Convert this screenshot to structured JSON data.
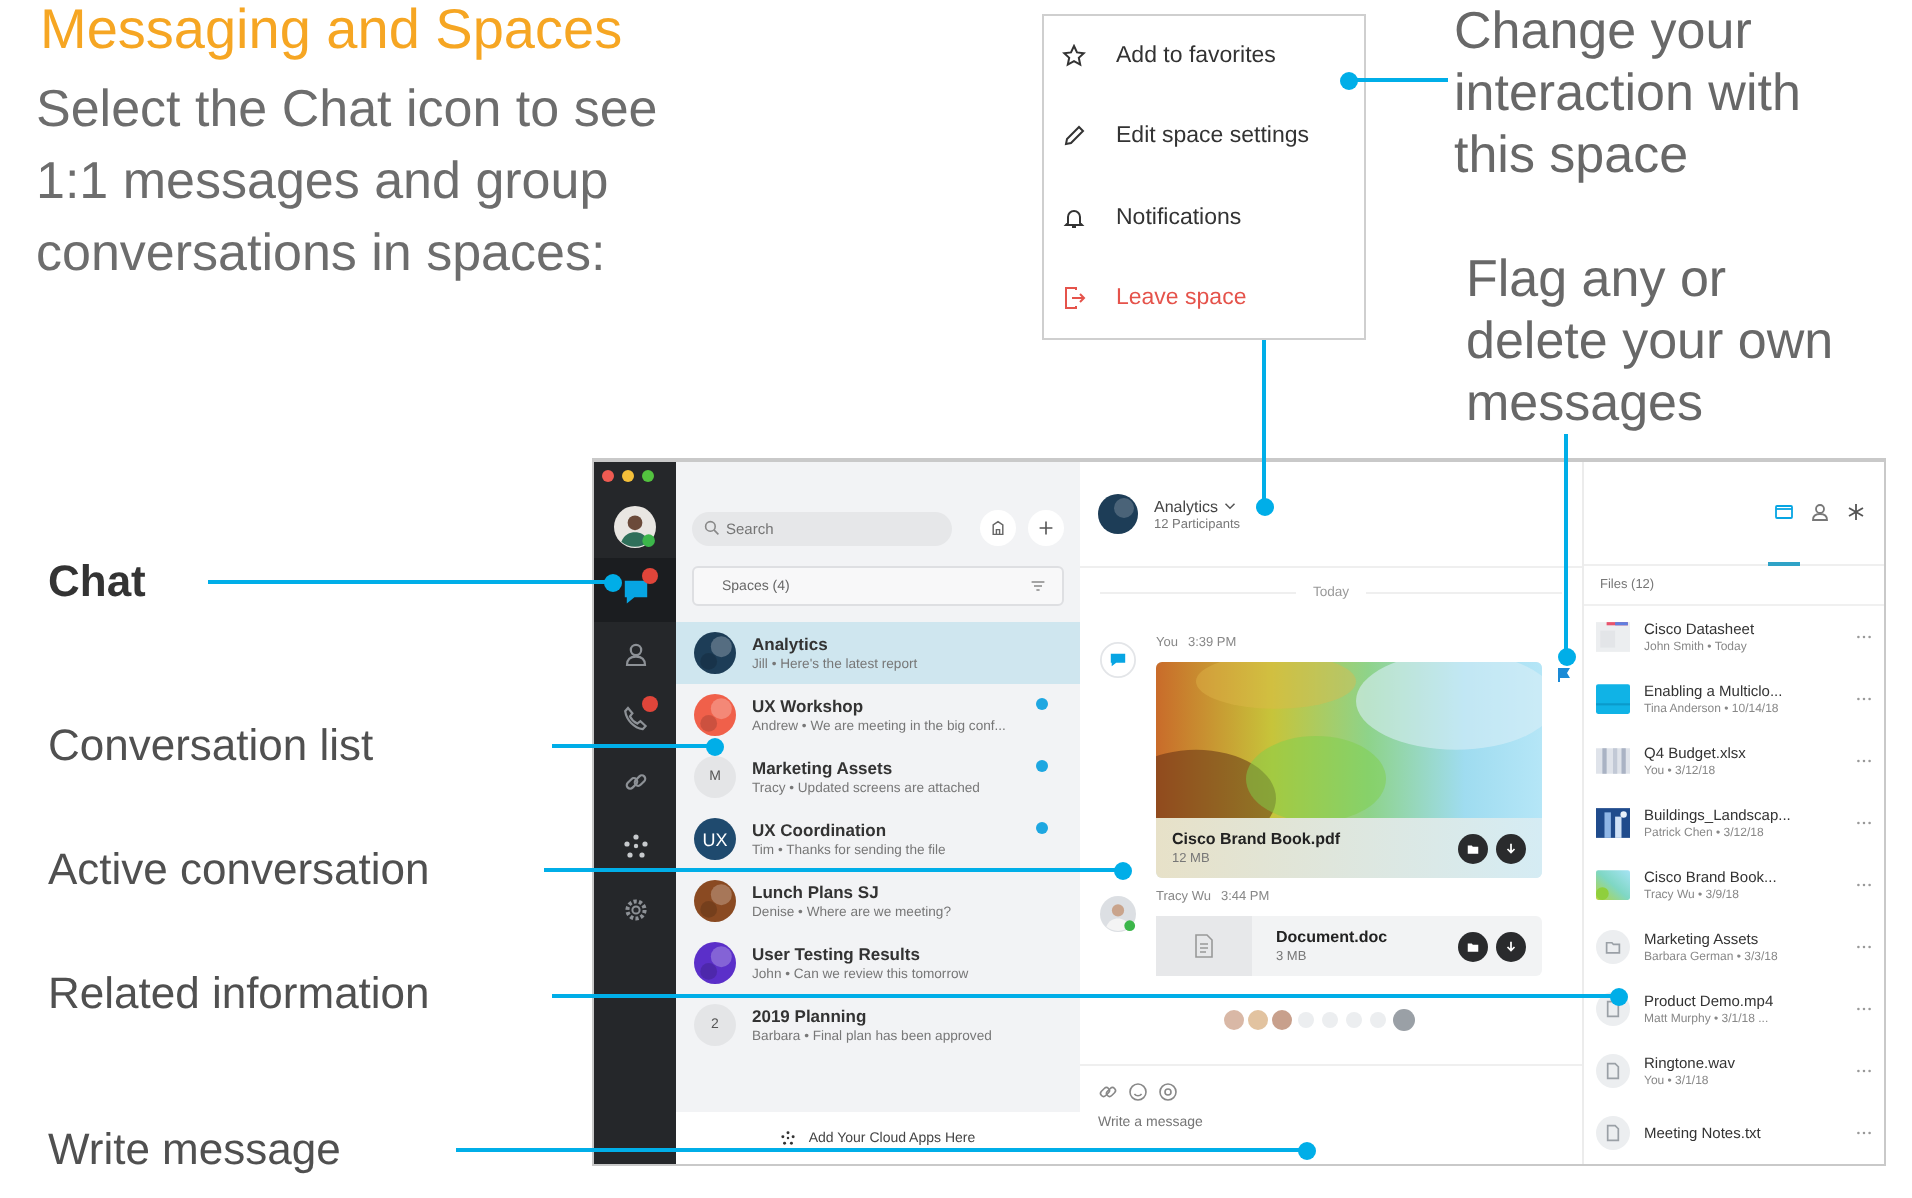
{
  "title": "Messaging and Spaces",
  "intro": "Select the Chat icon to see 1:1 messages and group conversations in spaces:",
  "space_menu": {
    "items": [
      {
        "kind": "favorite",
        "label": "Add to favorites"
      },
      {
        "kind": "edit",
        "label": "Edit space settings"
      },
      {
        "kind": "notifications",
        "label": "Notifications"
      },
      {
        "kind": "leave",
        "label": "Leave space"
      }
    ]
  },
  "callouts": {
    "menu": "Change your interaction with this space",
    "flag": "Flag any or delete your own messages",
    "chat": "Chat",
    "conversation_list": "Conversation list",
    "active_conversation": "Active conversation",
    "related_information": "Related information",
    "write_message": "Write message"
  },
  "app": {
    "sidebar": [
      {
        "kind": "avatar",
        "selected": false,
        "badge": false
      },
      {
        "kind": "chat",
        "selected": true,
        "badge": true
      },
      {
        "kind": "contacts",
        "selected": false,
        "badge": false
      },
      {
        "kind": "calls",
        "selected": false,
        "badge": true
      },
      {
        "kind": "link",
        "selected": false,
        "badge": false
      },
      {
        "kind": "apps",
        "selected": false,
        "badge": false
      },
      {
        "kind": "settings",
        "selected": false,
        "badge": false
      }
    ],
    "search": {
      "placeholder": "Search"
    },
    "filter": "Spaces (4)",
    "spaces": [
      {
        "name": "Analytics",
        "preview": "Jill • Here's the latest report",
        "selected": true,
        "unread": false
      },
      {
        "name": "UX Workshop",
        "preview": "Andrew • We are meeting in the big conf...",
        "selected": false,
        "unread": true
      },
      {
        "name": "Marketing Assets",
        "preview": "Tracy • Updated screens are attached",
        "selected": false,
        "unread": true,
        "avatar": {
          "kind": "initials",
          "text": "M",
          "color": "#e4e5e7"
        }
      },
      {
        "name": "UX Coordination",
        "preview": "Tim • Thanks for sending the file",
        "selected": false,
        "unread": true,
        "avatar": {
          "kind": "initials",
          "text": "UX",
          "color": "#1f4a6e"
        }
      },
      {
        "name": "Lunch Plans SJ",
        "preview": "Denise • Where are we meeting?",
        "selected": false,
        "unread": false
      },
      {
        "name": "User Testing Results",
        "preview": "John • Can we review this tomorrow",
        "selected": false,
        "unread": false
      },
      {
        "name": "2019 Planning",
        "preview": "Barbara • Final plan has been approved",
        "selected": false,
        "unread": false,
        "avatar": {
          "kind": "initials",
          "text": "2",
          "color": "#e4e5e7"
        }
      }
    ],
    "footer": "Add Your Cloud Apps Here",
    "conversation": {
      "name": "Analytics",
      "participants": "12 Participants",
      "divider": "Today",
      "messages": [
        {
          "kind": "preview",
          "avatar": {
            "kind": "self"
          },
          "sender": "You",
          "time": "3:39 PM",
          "file": "Cisco Brand Book.pdf",
          "size": "12 MB",
          "flagged": true
        },
        {
          "kind": "document",
          "avatar": {
            "kind": "person"
          },
          "sender": "Tracy Wu",
          "time": "3:44 PM",
          "file": "Document.doc",
          "size": "3 MB",
          "flagged": false
        }
      ],
      "composer": {
        "placeholder": "Write a message"
      }
    },
    "panel": {
      "tabs": [
        {
          "kind": "files",
          "selected": true
        },
        {
          "kind": "people",
          "selected": false
        },
        {
          "kind": "apps",
          "selected": false
        }
      ],
      "header": "Files (12)",
      "files": [
        {
          "name": "Cisco Datasheet",
          "meta": "John Smith • Today",
          "thumb": {
            "kind": "document"
          }
        },
        {
          "name": "Enabling a Multiclo...",
          "meta": "Tina Anderson • 10/14/18",
          "thumb": {
            "kind": "blue"
          }
        },
        {
          "name": "Q4 Budget.xlsx",
          "meta": "You • 3/12/18",
          "thumb": {
            "kind": "sheet"
          }
        },
        {
          "name": "Buildings_Landscap...",
          "meta": "Patrick Chen • 3/12/18"
        },
        {
          "name": "Cisco Brand Book...",
          "meta": "Tracy Wu • 3/9/18",
          "thumb": {
            "kind": "gradient"
          }
        },
        {
          "name": "Marketing Assets",
          "meta": "Barbara German • 3/3/18",
          "thumb": {
            "kind": "folder"
          }
        },
        {
          "name": "Product Demo.mp4",
          "meta": "Matt Murphy • 3/1/18 ...",
          "thumb": {
            "kind": "file"
          }
        },
        {
          "name": "Ringtone.wav",
          "meta": "You • 3/1/18",
          "thumb": {
            "kind": "file"
          }
        },
        {
          "name": "Meeting Notes.txt",
          "thumb": {
            "kind": "file"
          }
        }
      ]
    }
  }
}
